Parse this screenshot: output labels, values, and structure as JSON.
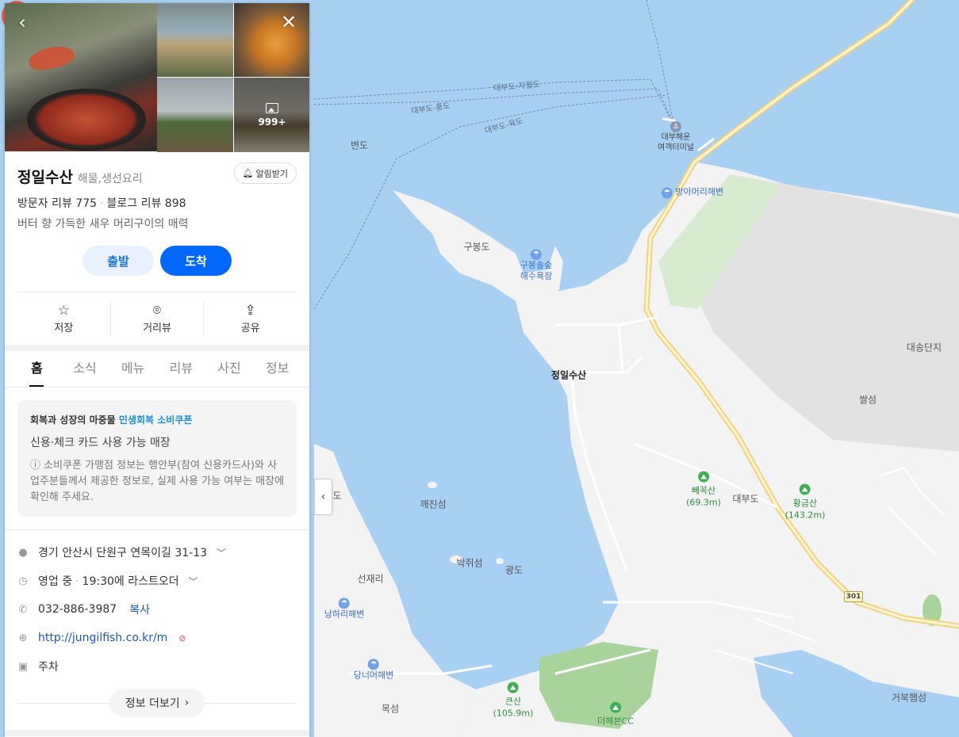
{
  "place": {
    "name": "정일수산",
    "category": "해물,생선요리",
    "alarm_label": "알림받기",
    "visitor_reviews": "방문자 리뷰 775",
    "blog_reviews": "블로그 리뷰 898",
    "description": "버터 향 가득한 새우 머리구이의 매력",
    "photo_count": "999+"
  },
  "route": {
    "start_label": "출발",
    "end_label": "도착"
  },
  "actions": [
    {
      "label": "저장",
      "icon": "star-icon"
    },
    {
      "label": "거리뷰",
      "icon": "location-pin-icon"
    },
    {
      "label": "공유",
      "icon": "share-icon"
    }
  ],
  "tabs": [
    "홈",
    "소식",
    "메뉴",
    "리뷰",
    "사진",
    "정보"
  ],
  "active_tab": "홈",
  "notice": {
    "prefix": "회복과 성장의 마중물",
    "highlight": "민생회복 소비쿠폰",
    "subtitle": "신용·체크 카드 사용 가능 매장",
    "info": "ⓘ 소비쿠폰 가맹점 정보는 행안부(참여 신용카드사)와 사업주분들께서 제공한 정보로, 실제 사용 가능 여부는 매장에 확인해 주세요."
  },
  "info": {
    "address": "경기 안산시 단원구 연목이길 31-13",
    "hours_status": "영업 중",
    "hours_detail": "19:30에 라스트오더",
    "phone": "032-886-3987",
    "copy_label": "복사",
    "website": "http://jungilfish.co.kr/m",
    "parking": "주차",
    "more_label": "정보 더보기"
  },
  "map": {
    "pin_label": "정일수산",
    "labels": {
      "byeondo": "변도",
      "gubongdo": "구봉도",
      "gubong_beach": "구봉솔숲\n해수욕장",
      "terminal": "대부해운\n여객터미널",
      "bangameori": "방아머리해변",
      "daesong": "대송단지",
      "ssalseom": "쌀섬",
      "ppaekkoksan": "빼꼭산\n(69.3m)",
      "daebudo": "대부도",
      "hwanggeumsan": "황금산\n(143.2m)",
      "kkaejinseom": "깨진섬",
      "bakjwiseom": "박쥐섬",
      "gwangdo": "광도",
      "seonjaeri": "선재리",
      "nanghari": "낭하리해변",
      "dangneomeo": "당너머해변",
      "mokseom": "목섬",
      "keunsan": "큰산\n(105.9m)",
      "theheben": "더헤븐CC",
      "geobukseom": "거북햄섬",
      "edge_do": "도"
    },
    "route_labels": [
      "대부도-자월도",
      "대부도-풍도",
      "대부도-육도"
    ],
    "road_number": "301"
  },
  "colors": {
    "water": "#a7d0f2",
    "land": "#f3f3f3",
    "accent": "#0068ff",
    "pin": "#e85a4a"
  }
}
